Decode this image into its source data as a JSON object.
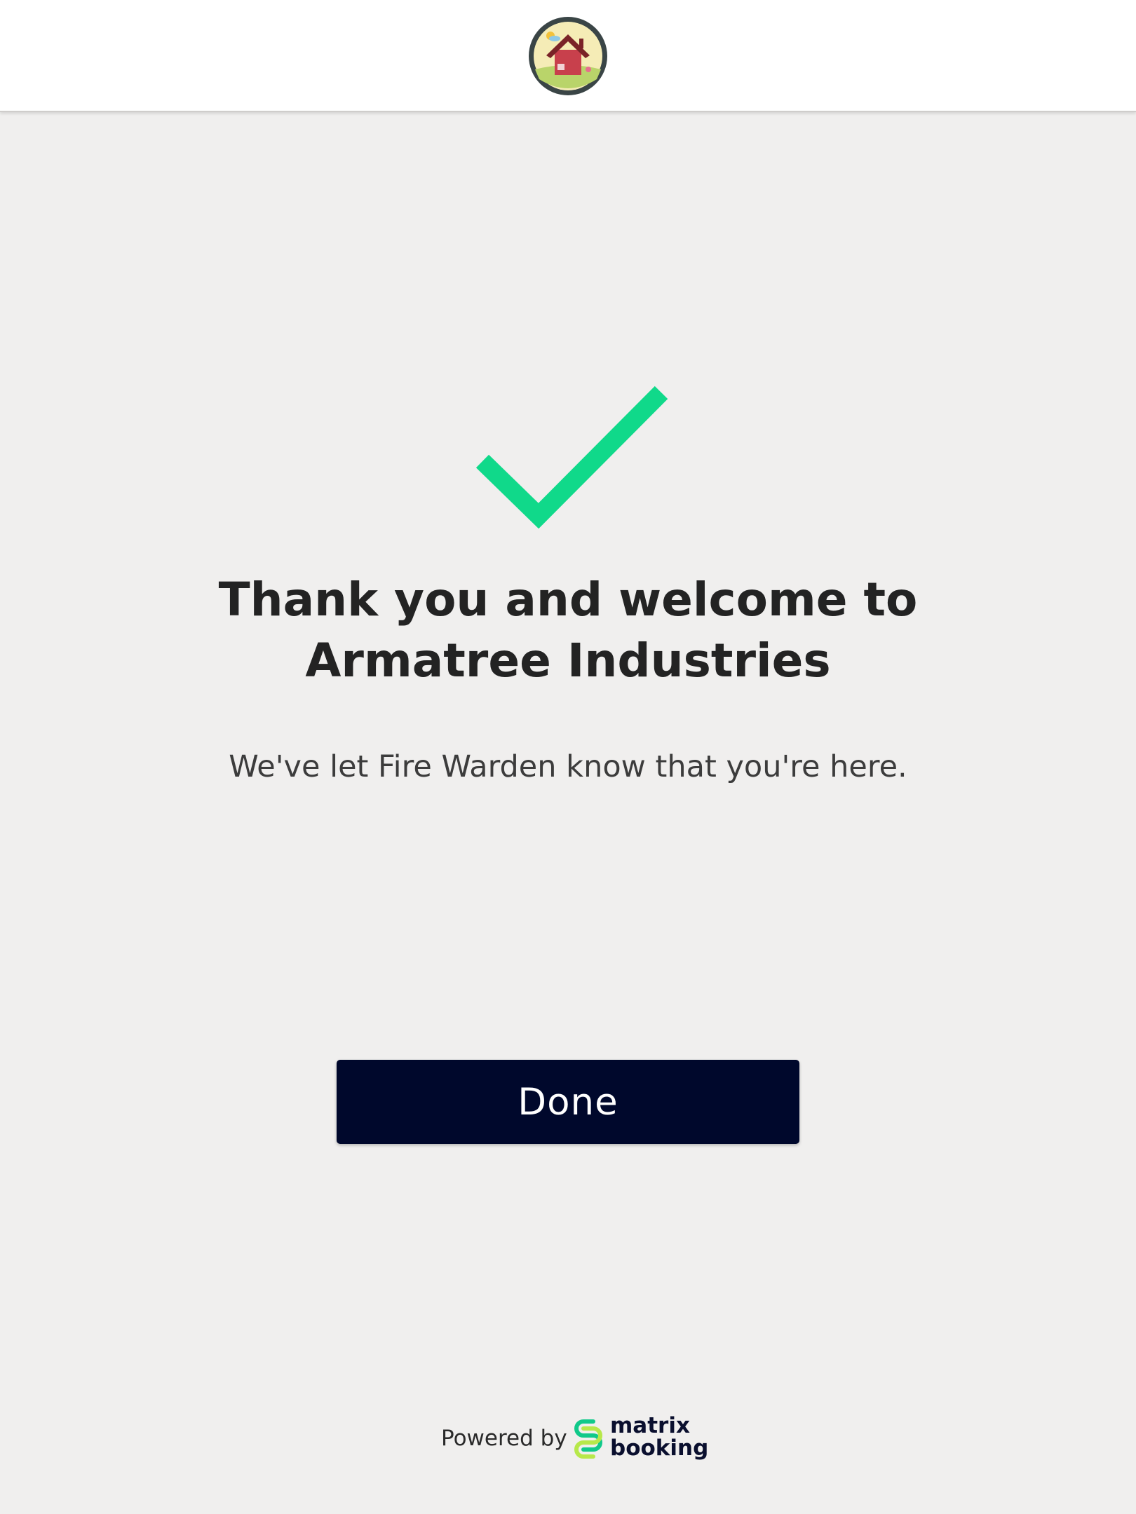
{
  "header": {
    "logo_icon": "house-logo-icon"
  },
  "confirmation": {
    "icon": "checkmark-icon",
    "icon_color": "#10d98a",
    "title_line1": "Thank you and welcome to",
    "title_line2": "Armatree Industries",
    "message": "We've let Fire Warden know that you're here."
  },
  "actions": {
    "done_label": "Done",
    "done_color": "#00082c"
  },
  "footer": {
    "powered_by": "Powered by",
    "brand_line1": "matrix",
    "brand_line2": "booking",
    "brand_icon": "matrix-booking-logo-icon"
  }
}
